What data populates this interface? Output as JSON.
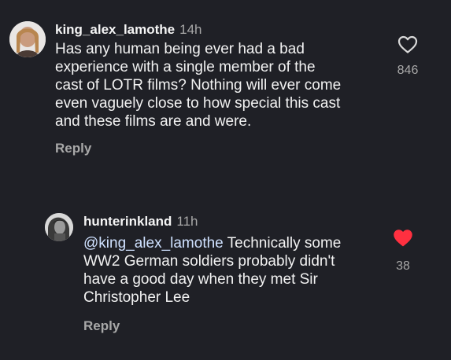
{
  "comments": [
    {
      "username": "king_alex_lamothe",
      "time": "14h",
      "lines": [
        "Has any human being ever had a bad",
        "experience with a single member of the",
        "cast of LOTR films? Nothing will ever come",
        "even vaguely close to how special this cast",
        "and these films are and were."
      ],
      "reply_label": "Reply",
      "like_count": "846",
      "liked": false,
      "heart_icon": "heart-outline-icon",
      "colors": {
        "heart": "#d9d9d9"
      }
    },
    {
      "username": "hunterinkland",
      "time": "11h",
      "mention": "@king_alex_lamothe",
      "first_line_rest": " Technically some",
      "lines": [
        "WW2 German soldiers probably didn't",
        "have a good day when they met Sir",
        "Christopher Lee"
      ],
      "reply_label": "Reply",
      "like_count": "38",
      "liked": true,
      "heart_icon": "heart-filled-icon",
      "colors": {
        "heart": "#ff3040"
      }
    }
  ],
  "colors": {
    "background": "#1f2026",
    "mention": "#cfe1ff",
    "secondary_text": "#a8a8a8"
  }
}
